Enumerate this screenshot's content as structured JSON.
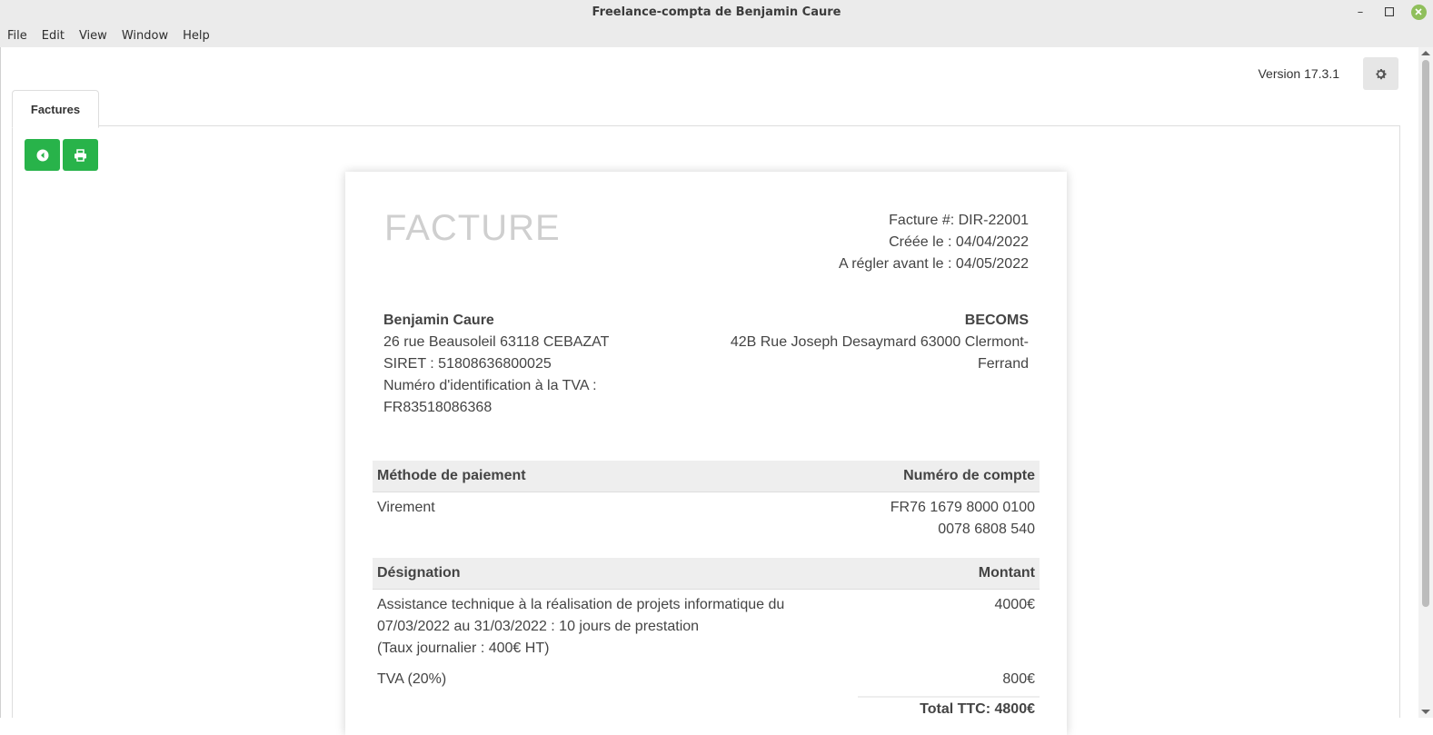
{
  "window": {
    "title": "Freelance-compta de Benjamin Caure",
    "minimize_icon": "minimize-icon",
    "maximize_icon": "maximize-icon",
    "close_icon": "close-icon"
  },
  "menu": [
    "File",
    "Edit",
    "View",
    "Window",
    "Help"
  ],
  "header": {
    "version": "Version 17.3.1",
    "settings_icon": "gear-icon"
  },
  "tabs": [
    {
      "label": "Factures",
      "active": true
    }
  ],
  "toolbar": {
    "back_icon": "arrow-left-circle-icon",
    "print_icon": "print-icon",
    "button_color": "#28b34a"
  },
  "invoice": {
    "heading": "FACTURE",
    "number": "Facture #: DIR-22001",
    "created": "Créée le : 04/04/2022",
    "due": "A régler avant le : 04/05/2022",
    "from": {
      "name": "Benjamin Caure",
      "address": "26 rue Beausoleil 63118 CEBAZAT",
      "siret": "SIRET : 51808636800025",
      "vat_label": "Numéro d'identification à la TVA :",
      "vat_number": "FR83518086368"
    },
    "to": {
      "name": "BECOMS",
      "address": "42B Rue Joseph Desaymard 63000 Clermont-Ferrand"
    },
    "payment": {
      "header_method": "Méthode de paiement",
      "header_account": "Numéro de compte",
      "method": "Virement",
      "account": "FR76 1679 8000 0100 0078 6808 540"
    },
    "items": {
      "header_designation": "Désignation",
      "header_amount": "Montant",
      "rows": [
        {
          "line1": "Assistance technique à la réalisation de projets informatique du 07/03/2022 au 31/03/2022 : 10 jours de prestation",
          "line2": "(Taux journalier : 400€ HT)",
          "amount": "4000€"
        }
      ],
      "tva_label": "TVA (20%)",
      "tva_amount": "800€",
      "total": "Total TTC: 4800€"
    }
  }
}
